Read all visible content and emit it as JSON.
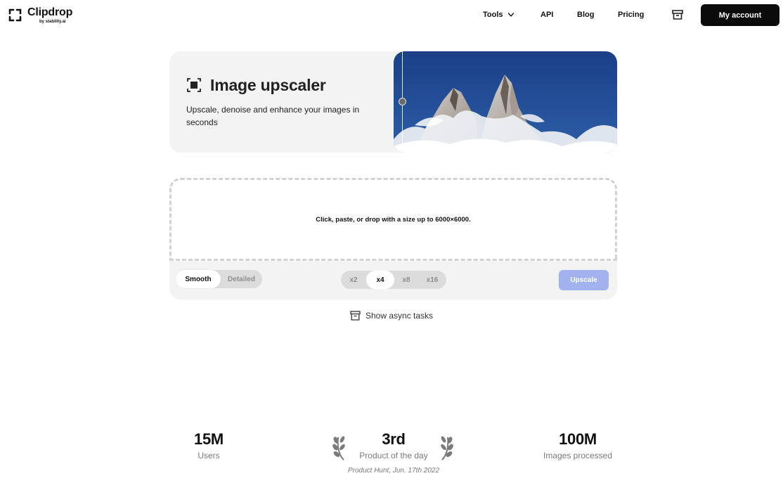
{
  "header": {
    "logo_name": "Clipdrop",
    "logo_sub": "by stability.ai",
    "nav": {
      "tools": "Tools",
      "api": "API",
      "blog": "Blog",
      "pricing": "Pricing"
    },
    "account_label": "My account"
  },
  "hero": {
    "title": "Image upscaler",
    "description": "Upscale, denoise and enhance your images in seconds"
  },
  "dropzone": {
    "text": "Click, paste, or drop with a size up to 6000×6000."
  },
  "controls": {
    "modes": [
      "Smooth",
      "Detailed"
    ],
    "selected_mode": "Smooth",
    "scales": [
      "x2",
      "x4",
      "x8",
      "x16"
    ],
    "selected_scale": "x4",
    "upscale_label": "Upscale"
  },
  "async_label": "Show async tasks",
  "stats": {
    "users": {
      "value": "15M",
      "label": "Users"
    },
    "product": {
      "value": "3rd",
      "label": "Product of the day",
      "note": "Product Hunt, Jun. 17th 2022"
    },
    "images": {
      "value": "100M",
      "label": "Images processed"
    }
  },
  "colors": {
    "accent_button": "#a1b2ee",
    "dark_button": "#0b0b0b",
    "panel_bg": "#f3f3f3"
  }
}
